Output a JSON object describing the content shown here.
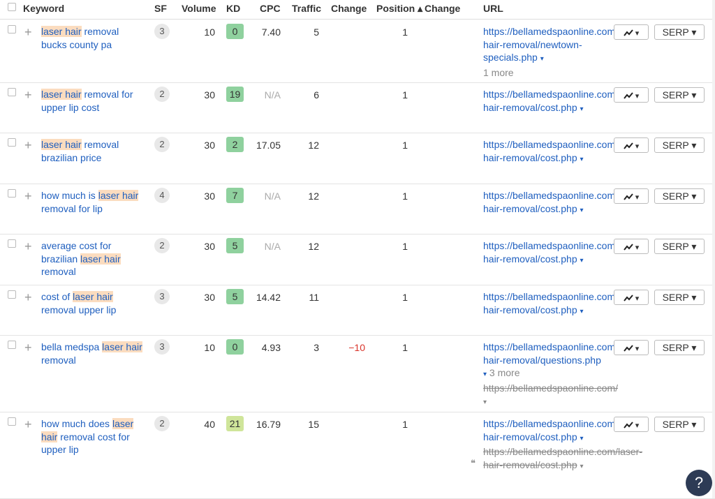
{
  "header": {
    "keyword": "Keyword",
    "sf": "SF",
    "volume": "Volume",
    "kd": "KD",
    "cpc": "CPC",
    "traffic": "Traffic",
    "change": "Change",
    "position": "Position ▴",
    "position_change": "Change",
    "url": "URL"
  },
  "rows": [
    {
      "kw_parts": [
        {
          "t": "laser hair",
          "hl": true
        },
        {
          "t": " removal bucks county pa",
          "hl": false
        }
      ],
      "sf": "3",
      "volume": "10",
      "kd": "0",
      "kd_color": "#8fd19e",
      "cpc": "7.40",
      "traffic": "5",
      "change": "",
      "position": "1",
      "url": "https://bellamedspaonline.com/laser-hair-removal/newtown-specials.php",
      "url_more": "1 more"
    },
    {
      "kw_parts": [
        {
          "t": "laser hair",
          "hl": true
        },
        {
          "t": " removal for upper lip cost",
          "hl": false
        }
      ],
      "sf": "2",
      "volume": "30",
      "kd": "19",
      "kd_color": "#8fd19e",
      "cpc": "N/A",
      "traffic": "6",
      "change": "",
      "position": "1",
      "url": "https://bellamedspaonline.com/laser-hair-removal/cost.php"
    },
    {
      "kw_parts": [
        {
          "t": "laser hair",
          "hl": true
        },
        {
          "t": " removal brazilian price",
          "hl": false
        }
      ],
      "sf": "2",
      "volume": "30",
      "kd": "2",
      "kd_color": "#8fd19e",
      "cpc": "17.05",
      "traffic": "12",
      "change": "",
      "position": "1",
      "url": "https://bellamedspaonline.com/laser-hair-removal/cost.php"
    },
    {
      "kw_parts": [
        {
          "t": "how much is ",
          "hl": false
        },
        {
          "t": "laser hair",
          "hl": true
        },
        {
          "t": " removal for lip",
          "hl": false
        }
      ],
      "sf": "4",
      "volume": "30",
      "kd": "7",
      "kd_color": "#8fd19e",
      "cpc": "N/A",
      "traffic": "12",
      "change": "",
      "position": "1",
      "url": "https://bellamedspaonline.com/laser-hair-removal/cost.php"
    },
    {
      "kw_parts": [
        {
          "t": "average cost for brazilian ",
          "hl": false
        },
        {
          "t": "laser hair",
          "hl": true
        },
        {
          "t": " removal",
          "hl": false
        }
      ],
      "sf": "2",
      "volume": "30",
      "kd": "5",
      "kd_color": "#8fd19e",
      "cpc": "N/A",
      "traffic": "12",
      "change": "",
      "position": "1",
      "url": "https://bellamedspaonline.com/laser-hair-removal/cost.php"
    },
    {
      "kw_parts": [
        {
          "t": "cost of ",
          "hl": false
        },
        {
          "t": "laser hair",
          "hl": true
        },
        {
          "t": " removal upper lip",
          "hl": false
        }
      ],
      "sf": "3",
      "volume": "30",
      "kd": "5",
      "kd_color": "#8fd19e",
      "cpc": "14.42",
      "traffic": "11",
      "change": "",
      "position": "1",
      "url": "https://bellamedspaonline.com/laser-hair-removal/cost.php"
    },
    {
      "kw_parts": [
        {
          "t": "bella medspa ",
          "hl": false
        },
        {
          "t": "laser hair",
          "hl": true
        },
        {
          "t": " removal",
          "hl": false
        }
      ],
      "sf": "3",
      "volume": "10",
      "kd": "0",
      "kd_color": "#8fd19e",
      "cpc": "4.93",
      "traffic": "3",
      "change": "−10",
      "position": "1",
      "url": "https://bellamedspaonline.com/laser-hair-removal/questions.php",
      "url_more": "3 more",
      "url_old": "https://bellamedspaonline.com/"
    },
    {
      "kw_parts": [
        {
          "t": "how much does ",
          "hl": false
        },
        {
          "t": "laser hair",
          "hl": true
        },
        {
          "t": " removal cost for upper lip",
          "hl": false
        }
      ],
      "sf": "2",
      "volume": "40",
      "kd": "21",
      "kd_color": "#cfe59a",
      "cpc": "16.79",
      "traffic": "15",
      "change": "",
      "position": "1",
      "url": "https://bellamedspaonline.com/laser-hair-removal/cost.php",
      "url_old": "https://bellamedspaonline.com/laser-hair-removal/cost.php"
    }
  ],
  "buttons": {
    "trend_caret": "▾",
    "serp_label": "SERP ▾"
  },
  "help_label": "?"
}
